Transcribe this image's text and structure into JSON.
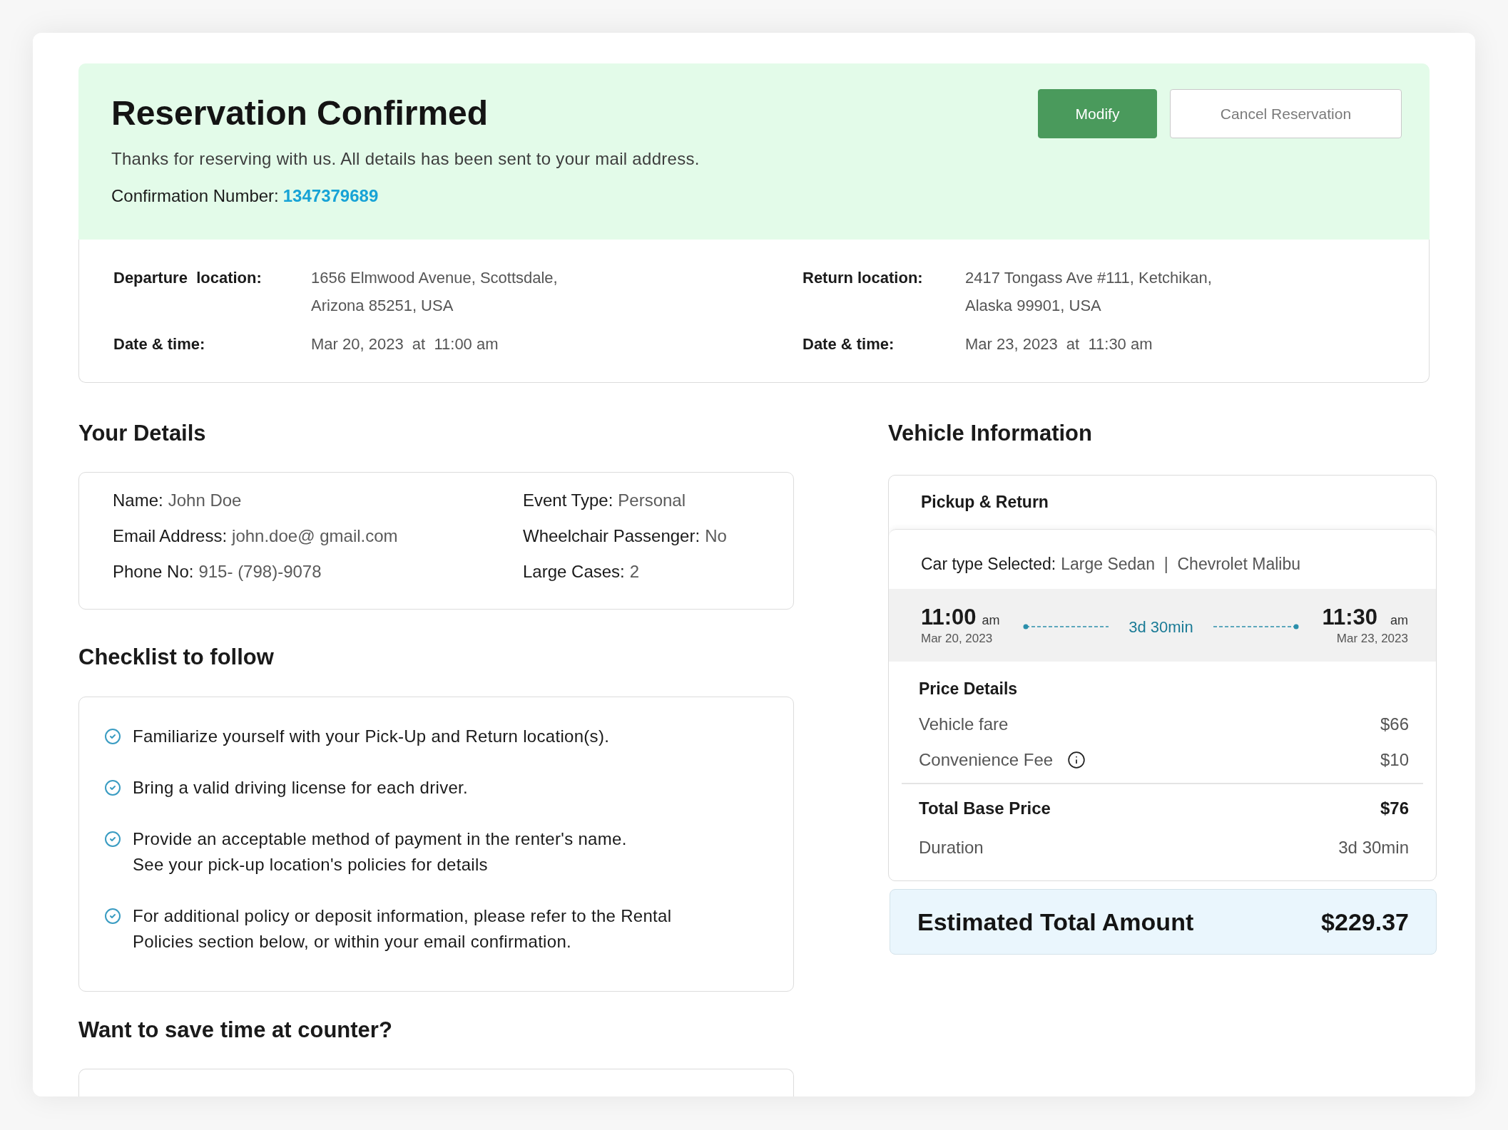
{
  "header": {
    "title": "Reservation Confirmed",
    "message": "Thanks for reserving with us. All details has been sent to your mail address.",
    "confirmation": {
      "label": "Confirmation Number:",
      "value": "1347379689"
    },
    "buttons": [
      {
        "label": "Modify",
        "kind": "primary"
      },
      {
        "label": "Cancel Reservation",
        "kind": "secondary"
      }
    ]
  },
  "trip": [
    {
      "location_label": "Departure  location:",
      "address_lines": [
        "1656 Elmwood Avenue, Scottsdale,",
        "Arizona 85251, USA"
      ],
      "datetime_label": "Date & time:",
      "datetime": "Mar 20, 2023  at  11:00 am"
    },
    {
      "location_label": "Return location:",
      "address_lines": [
        "2417 Tongass Ave #111, Ketchikan,",
        "Alaska 99901, USA"
      ],
      "datetime_label": "Date & time:",
      "datetime": "Mar 23, 2023  at  11:30 am"
    }
  ],
  "your_details": {
    "heading": "Your Details",
    "columns": [
      [
        {
          "label": "Name:",
          "value": "John Doe"
        },
        {
          "label": "Email Address:",
          "value": "john.doe@ gmail.com"
        },
        {
          "label": "Phone No:",
          "value": "915- (798)-9078"
        }
      ],
      [
        {
          "label": "Event Type:",
          "value": "Personal"
        },
        {
          "label": "Wheelchair Passenger:",
          "value": "No"
        },
        {
          "label": "Large Cases:",
          "value": "2"
        }
      ]
    ]
  },
  "checklist": {
    "heading": "Checklist to follow",
    "items": [
      {
        "lines": [
          "Familiarize yourself with your Pick-Up and Return location(s)."
        ]
      },
      {
        "lines": [
          "Bring a valid driving license for each driver."
        ]
      },
      {
        "lines": [
          "Provide an acceptable method of payment in the renter's name.",
          "See your pick-up location's policies for details"
        ]
      },
      {
        "lines": [
          "For additional policy or deposit information, please refer to the Rental",
          "Policies section below, or within your email confirmation."
        ]
      }
    ]
  },
  "save_time": {
    "heading": "Want to save time at counter?"
  },
  "vehicle": {
    "heading": "Vehicle Information",
    "section_title": "Pickup & Return",
    "car_type": {
      "label": "Car type Selected:",
      "value": "Large Sedan  |  Chevrolet Malibu"
    },
    "pickup": {
      "time": "11:00",
      "meridiem": "am",
      "date": "Mar 20, 2023"
    },
    "duration": "3d 30min",
    "return": {
      "time": "11:30",
      "meridiem": "am",
      "date": "Mar 23, 2023"
    },
    "price_details": {
      "title": "Price Details",
      "rows": [
        {
          "kind": "line",
          "label": "Vehicle fare",
          "value": "$66"
        },
        {
          "kind": "line",
          "label": "Convenience Fee",
          "value": "$10",
          "info": true
        },
        {
          "kind": "total",
          "label": "Total Base Price",
          "value": "$76"
        },
        {
          "kind": "line",
          "label": "Duration",
          "value": "3d 30min"
        }
      ]
    }
  },
  "estimate": {
    "label": "Estimated Total Amount",
    "value": "$229.37"
  }
}
